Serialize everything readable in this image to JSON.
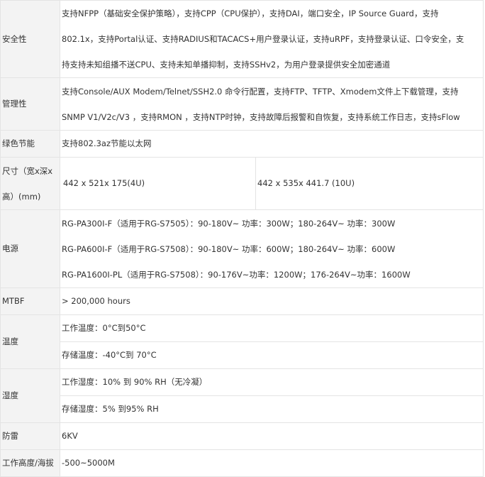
{
  "rows": {
    "security": {
      "label": "安全性",
      "lines": [
        "支持NFPP（基础安全保护策略），支持CPP（CPU保护），支持DAI，端口安全，IP Source Guard，支持",
        "802.1x，支持Portal认证、支持RADIUS和TACACS+用户登录认证，支持uRPF，支持登录认证、口令安全，支",
        "持支持未知组播不送CPU、支持未知单播抑制，支持SSHv2，为用户登录提供安全加密通道"
      ]
    },
    "management": {
      "label": "管理性",
      "lines": [
        "支持Console/AUX Modem/Telnet/SSH2.0 命令行配置，支持FTP、TFTP、Xmodem文件上下载管理，支持",
        "SNMP V1/V2c/V3 ，支持RMON ，支持NTP时钟，支持故障后报警和自恢复，支持系统工作日志，支持sFlow"
      ]
    },
    "green": {
      "label": "绿色节能",
      "value": "支持802.3az节能以太网"
    },
    "dimensions": {
      "label_lines": [
        "尺寸（宽x深x",
        "高）(mm)"
      ],
      "value_a": "442 x 521x 175(4U)",
      "value_b": "442 x 535x 441.7 (10U)"
    },
    "power": {
      "label": "电源",
      "lines": [
        "RG-PA300I-F（适用于RG-S7505）：90-180V~ 功率：300W；180-264V~ 功率：300W",
        "RG-PA600I-F（适用于RG-S7508）：90-180V~ 功率：600W；180-264V~ 功率：600W",
        "RG-PA1600I-PL（适用于RG-S7508）：90-176V~功率：1200W；176-264V~功率：1600W"
      ]
    },
    "mtbf": {
      "label": "MTBF",
      "value": "> 200,000 hours"
    },
    "temperature": {
      "label": "温度",
      "working": "工作温度：0°C到50°C",
      "storage": "存储温度：-40°C到 70°C"
    },
    "humidity": {
      "label": "湿度",
      "working": "工作湿度：10% 到 90% RH（无冷凝）",
      "storage": "存储湿度：5% 到95% RH"
    },
    "lightning": {
      "label": "防雷",
      "value": "6KV"
    },
    "altitude": {
      "label": "工作高度/海拔",
      "value": "-500~5000M"
    }
  }
}
